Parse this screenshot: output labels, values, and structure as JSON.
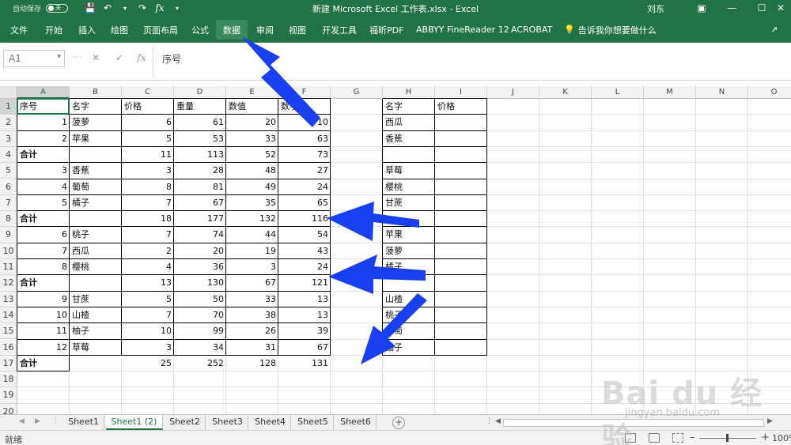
{
  "titlebar": {
    "autosave_label": "自动保存",
    "autosave_state": "关",
    "title": "新建 Microsoft Excel 工作表.xlsx  -  Excel",
    "user": "刘东"
  },
  "ribbon": {
    "tabs": [
      "文件",
      "开始",
      "插入",
      "绘图",
      "页面布局",
      "公式",
      "数据",
      "审阅",
      "视图",
      "开发工具",
      "福昕PDF",
      "ABBYY FineReader 12",
      "ACROBAT"
    ],
    "active_tab": "数据",
    "tell_me": "告诉我你想要做什么"
  },
  "formula_bar": {
    "name_box": "A1",
    "content": "序号"
  },
  "columns": [
    "A",
    "B",
    "C",
    "D",
    "E",
    "F",
    "G",
    "H",
    "I",
    "J",
    "K",
    "L",
    "M",
    "N",
    "O"
  ],
  "rows": [
    "1",
    "2",
    "3",
    "4",
    "5",
    "6",
    "7",
    "8",
    "9",
    "10",
    "11",
    "12",
    "13",
    "14",
    "15",
    "16",
    "17",
    "18",
    "19",
    "20"
  ],
  "table1": {
    "headers": [
      "序号",
      "名字",
      "价格",
      "重量",
      "数值",
      "数字"
    ],
    "rows": [
      [
        "1",
        "菠萝",
        "6",
        "61",
        "20",
        "10"
      ],
      [
        "2",
        "苹果",
        "5",
        "53",
        "33",
        "63"
      ],
      [
        "合计",
        "",
        "11",
        "113",
        "52",
        "73"
      ],
      [
        "3",
        "香蕉",
        "3",
        "28",
        "48",
        "27"
      ],
      [
        "4",
        "葡萄",
        "8",
        "81",
        "49",
        "24"
      ],
      [
        "5",
        "橘子",
        "7",
        "67",
        "35",
        "65"
      ],
      [
        "合计",
        "",
        "18",
        "177",
        "132",
        "116"
      ],
      [
        "6",
        "桃子",
        "7",
        "74",
        "44",
        "54"
      ],
      [
        "7",
        "西瓜",
        "2",
        "20",
        "19",
        "43"
      ],
      [
        "8",
        "樱桃",
        "4",
        "36",
        "3",
        "24"
      ],
      [
        "合计",
        "",
        "13",
        "130",
        "67",
        "121"
      ],
      [
        "9",
        "甘蔗",
        "5",
        "50",
        "33",
        "13"
      ],
      [
        "10",
        "山楂",
        "7",
        "70",
        "38",
        "13"
      ],
      [
        "11",
        "柚子",
        "10",
        "99",
        "26",
        "39"
      ],
      [
        "12",
        "草莓",
        "3",
        "34",
        "31",
        "67"
      ],
      [
        "合计",
        "",
        "25",
        "252",
        "128",
        "131"
      ]
    ]
  },
  "table2": {
    "headers": [
      "名字",
      "价格"
    ],
    "names": [
      "西瓜",
      "香蕉",
      "",
      "草莓",
      "樱桃",
      "甘蔗",
      "",
      "苹果",
      "菠萝",
      "橘子",
      "",
      "山楂",
      "桃子",
      "葡萄",
      "柚子"
    ]
  },
  "sheet_tabs": [
    "Sheet1",
    "Sheet1 (2)",
    "Sheet2",
    "Sheet3",
    "Sheet4",
    "Sheet5",
    "Sheet6"
  ],
  "active_sheet": "Sheet1 (2)",
  "status": {
    "ready": "就绪",
    "zoom": "100%"
  },
  "watermark": {
    "main": "Bai du 经验",
    "sub": "jingyan.baidu.com"
  },
  "colors": {
    "excel_green": "#217346",
    "arrow_blue": "#1a3ff0"
  }
}
